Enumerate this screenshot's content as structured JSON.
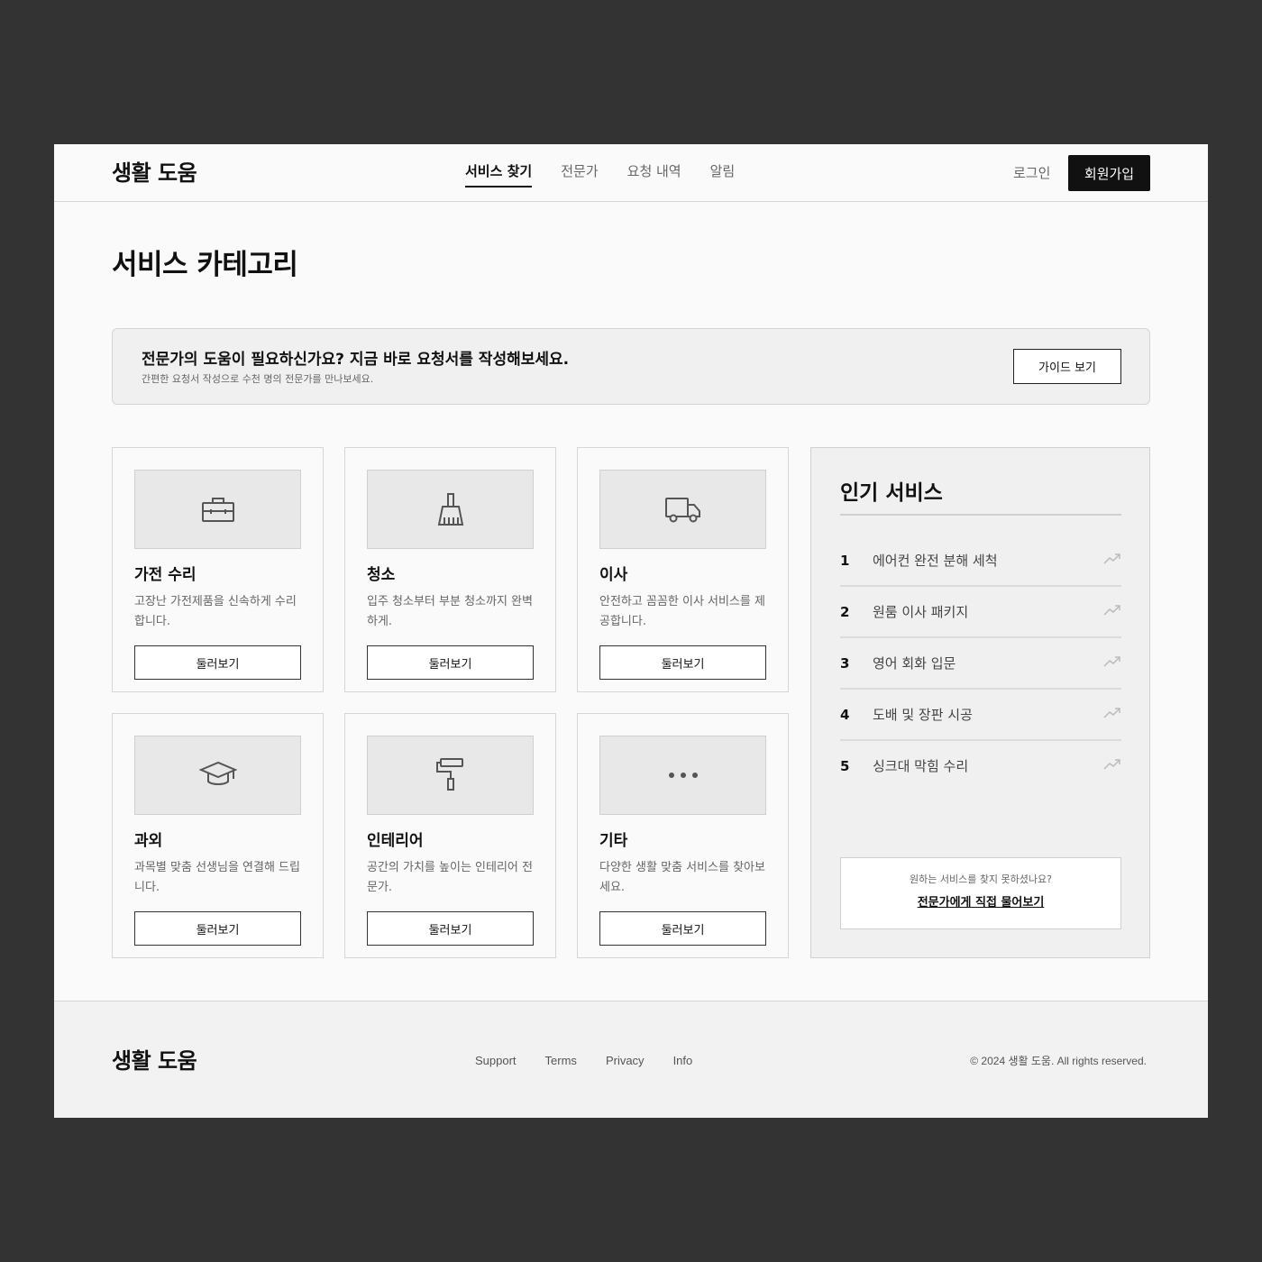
{
  "brand": "생활 도움",
  "nav": {
    "items": [
      "서비스 찾기",
      "전문가",
      "요청 내역",
      "알림"
    ],
    "login": "로그인",
    "signup": "회원가입"
  },
  "page_title": "서비스 카테고리",
  "banner": {
    "title": "전문가의 도움이 필요하신가요? 지금 바로 요청서를 작성해보세요.",
    "subtitle": "간편한 요청서 작성으로 수천 명의 전문가를 만나보세요.",
    "button": "가이드 보기"
  },
  "categories": [
    {
      "title": "가전 수리",
      "description": "고장난 가전제품을 신속하게 수리합니다.",
      "button": "둘러보기",
      "icon": "toolbox-icon"
    },
    {
      "title": "청소",
      "description": "입주 청소부터 부분 청소까지 완벽하게.",
      "button": "둘러보기",
      "icon": "brush-icon"
    },
    {
      "title": "이사",
      "description": "안전하고 꼼꼼한 이사 서비스를 제공합니다.",
      "button": "둘러보기",
      "icon": "truck-icon"
    },
    {
      "title": "과외",
      "description": "과목별 맞춤 선생님을 연결해 드립니다.",
      "button": "둘러보기",
      "icon": "graduation-cap-icon"
    },
    {
      "title": "인테리어",
      "description": "공간의 가치를 높이는 인테리어 전문가.",
      "button": "둘러보기",
      "icon": "paint-roller-icon"
    },
    {
      "title": "기타",
      "description": "다양한 생활 맞춤 서비스를 찾아보세요.",
      "button": "둘러보기",
      "icon": "more-dots-icon"
    }
  ],
  "popular": {
    "title": "인기 서비스",
    "items": [
      {
        "rank": "1",
        "name": "에어컨 완전 분해 세척"
      },
      {
        "rank": "2",
        "name": "원룸 이사 패키지"
      },
      {
        "rank": "3",
        "name": "영어 회화 입문"
      },
      {
        "rank": "4",
        "name": "도배 및 장판 시공"
      },
      {
        "rank": "5",
        "name": "싱크대 막힘 수리"
      }
    ],
    "trend_icon": "trending-up-icon",
    "ask_question": "원하는 서비스를 찾지 못하셨나요?",
    "ask_link": "전문가에게 직접 물어보기"
  },
  "footer": {
    "brand": "생활 도움",
    "links": [
      "Support",
      "Terms",
      "Privacy",
      "Info"
    ],
    "copyright": "© 2024 생활 도움. All rights reserved."
  }
}
